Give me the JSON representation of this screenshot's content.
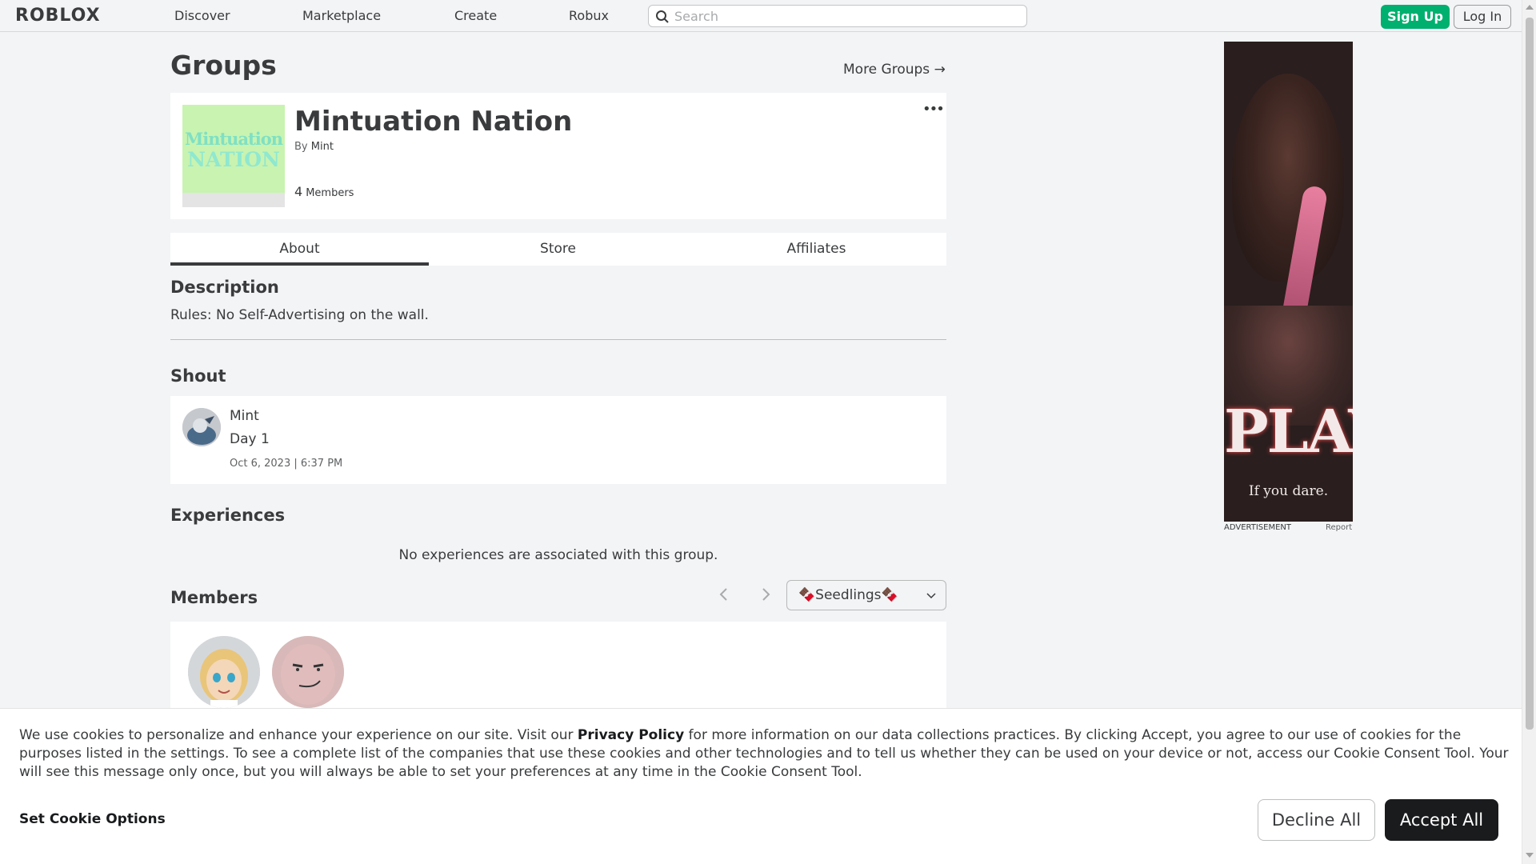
{
  "nav": {
    "logo": "ROBLOX",
    "links": [
      "Discover",
      "Marketplace",
      "Create",
      "Robux"
    ],
    "search_placeholder": "Search",
    "signup_label": "Sign Up",
    "login_label": "Log In"
  },
  "page": {
    "title": "Groups",
    "more_groups_label": "More Groups →"
  },
  "group": {
    "name": "Mintuation Nation",
    "by_label": "By",
    "owner": "Mint",
    "member_count": "4",
    "members_label": "Members",
    "emblem_line1": "Mintuation",
    "emblem_line2": "NATION",
    "more_icon": "•••"
  },
  "tabs": [
    "About",
    "Store",
    "Affiliates"
  ],
  "description": {
    "title": "Description",
    "text": "Rules: No Self-Advertising on the wall."
  },
  "shout": {
    "title": "Shout",
    "author": "Mint",
    "body": "Day 1",
    "date": "Oct 6, 2023 | 6:37 PM"
  },
  "experiences": {
    "title": "Experiences",
    "empty_text": "No experiences are associated with this group."
  },
  "members": {
    "title": "Members",
    "rank_selected": "🍫Seedlings🍫"
  },
  "ad": {
    "headline": "PLAY",
    "tagline": "If you dare.",
    "caption": "ADVERTISEMENT",
    "report_label": "Report"
  },
  "cookie": {
    "text_before": "We use cookies to personalize and enhance your experience on our site. Visit our ",
    "policy_link": "Privacy Policy",
    "text_after": " for more information on our data collections practices. By clicking Accept, you agree to our use of cookies for the purposes listed in the settings. To see a complete list of the companies that use these cookies and other technologies and to tell us whether they can be used on your device or not, access our Cookie Consent Tool. Your will see this message only once, but you will always be able to set your preferences at any time in the Cookie Consent Tool.",
    "options_label": "Set Cookie Options",
    "decline_label": "Decline All",
    "accept_label": "Accept All"
  },
  "colors": {
    "accent_green": "#00b06f",
    "page_bg": "#f2f4f5",
    "text": "#393b3d"
  }
}
